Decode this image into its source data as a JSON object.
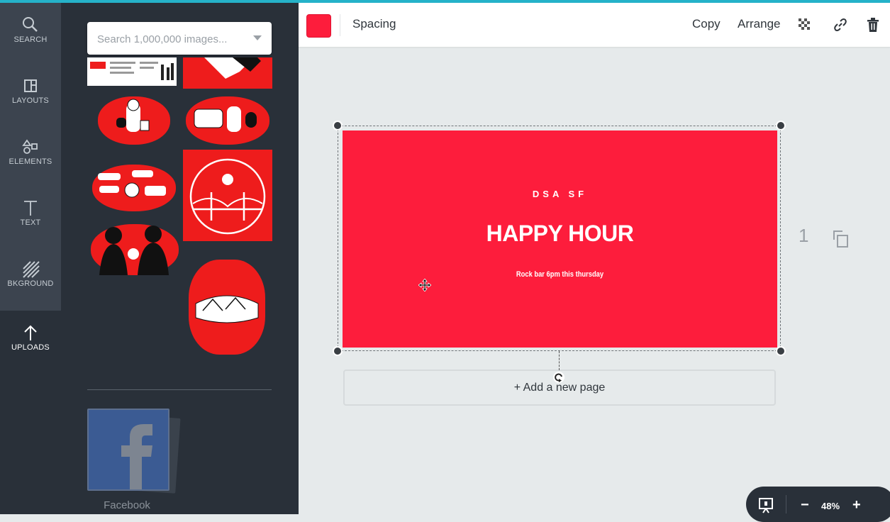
{
  "sidebar": {
    "items": [
      {
        "label": "SEARCH",
        "icon": "search-icon"
      },
      {
        "label": "LAYOUTS",
        "icon": "layouts-icon"
      },
      {
        "label": "ELEMENTS",
        "icon": "elements-icon"
      },
      {
        "label": "TEXT",
        "icon": "text-icon"
      },
      {
        "label": "BKGROUND",
        "icon": "background-icon"
      },
      {
        "label": "UPLOADS",
        "icon": "upload-icon"
      }
    ],
    "active": "UPLOADS"
  },
  "panel": {
    "search_placeholder": "Search 1,000,000 images...",
    "facebook_label": "Facebook"
  },
  "toolbar": {
    "color": "#fd1d3c",
    "spacing_label": "Spacing",
    "copy_label": "Copy",
    "arrange_label": "Arrange",
    "icons": [
      "transparency-icon",
      "link-icon",
      "trash-icon"
    ]
  },
  "design": {
    "org": "DSA SF",
    "title": "HAPPY HOUR",
    "subtitle": "Rock bar 6pm this thursday",
    "background": "#fd1d3c"
  },
  "canvas": {
    "page_number": "1",
    "add_page_label": "+ Add a new page"
  },
  "zoom": {
    "value": "48%",
    "minus": "−",
    "plus": "+"
  }
}
